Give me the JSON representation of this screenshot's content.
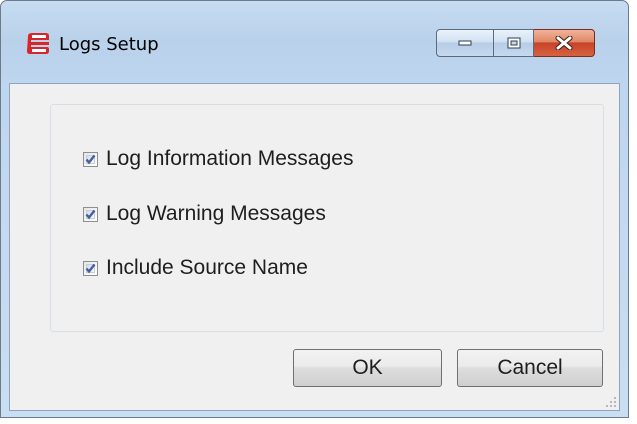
{
  "window": {
    "title": "Logs Setup",
    "app_icon": "logs-app-icon",
    "caption_buttons": [
      "minimize-icon",
      "maximize-icon",
      "close-icon"
    ]
  },
  "options": [
    {
      "label": "Log Information Messages",
      "checked": true
    },
    {
      "label": "Log Warning Messages",
      "checked": true
    },
    {
      "label": "Include Source Name",
      "checked": true
    }
  ],
  "buttons": {
    "ok_label": "OK",
    "cancel_label": "Cancel"
  },
  "colors": {
    "frame": "#b9d1ea",
    "client": "#f0f0f0",
    "close_button": "#c7432a",
    "check_mark": "#4a5f97"
  }
}
